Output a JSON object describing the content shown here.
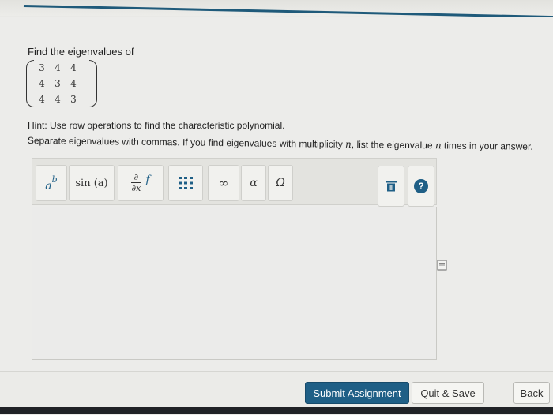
{
  "question": {
    "prompt": "Find the eigenvalues of",
    "matrix": [
      [
        "3",
        "4",
        "4"
      ],
      [
        "4",
        "3",
        "4"
      ],
      [
        "4",
        "4",
        "3"
      ]
    ],
    "hint": "Hint: Use row operations to find the characteristic polynomial.",
    "instructions": {
      "part1": "Separate eigenvalues with commas. If you find eigenvalues with multiplicity ",
      "var1": "n",
      "part2": ", list the eigenvalue ",
      "var2": "n",
      "part3": " times in your answer."
    }
  },
  "toolbar": {
    "power_base": "a",
    "power_exp": "b",
    "sin_label": "sin (a)",
    "partial_num": "∂",
    "partial_den": "∂x",
    "func_label": "f",
    "infinity_label": "∞",
    "alpha_label": "α",
    "omega_label": "Ω",
    "help_label": "?"
  },
  "actions": {
    "submit_label": "Submit Assignment",
    "quit_label": "Quit & Save",
    "back_label": "Back"
  }
}
